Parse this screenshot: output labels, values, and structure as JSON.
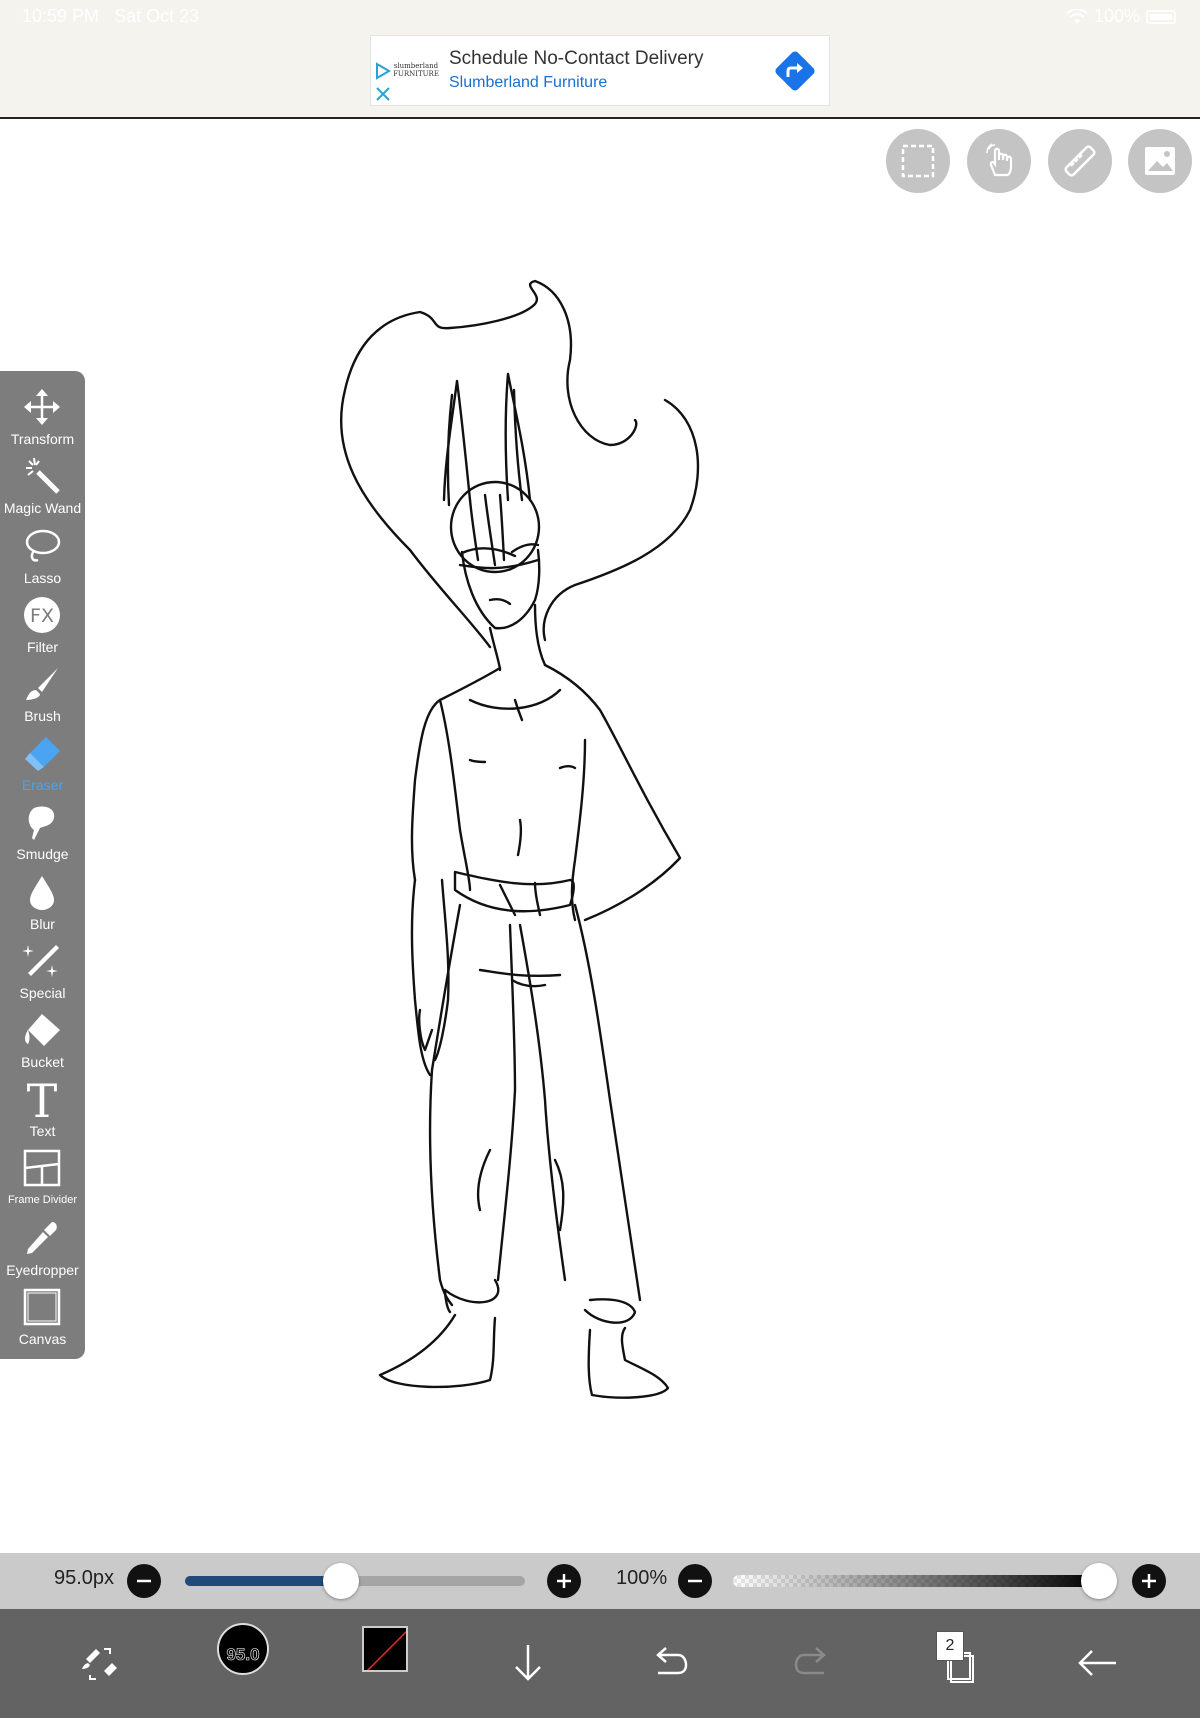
{
  "status_bar": {
    "time": "10:59 PM",
    "date": "Sat Oct 23",
    "battery": "100%"
  },
  "ad": {
    "logo_text": "slumberland FURNITURE",
    "title": "Schedule No-Contact Delivery",
    "subtitle": "Slumberland Furniture"
  },
  "top_buttons": [
    "selection-icon",
    "touch-hand-icon",
    "ruler-icon",
    "image-icon"
  ],
  "toolbar": {
    "tools": [
      {
        "name": "transform",
        "label": "Transform",
        "icon": "move-arrows-icon"
      },
      {
        "name": "magic-wand",
        "label": "Magic Wand",
        "icon": "magic-wand-icon"
      },
      {
        "name": "lasso",
        "label": "Lasso",
        "icon": "lasso-icon"
      },
      {
        "name": "filter",
        "label": "Filter",
        "icon": "fx-icon"
      },
      {
        "name": "brush",
        "label": "Brush",
        "icon": "brush-icon"
      },
      {
        "name": "eraser",
        "label": "Eraser",
        "icon": "eraser-icon"
      },
      {
        "name": "smudge",
        "label": "Smudge",
        "icon": "smudge-icon"
      },
      {
        "name": "blur",
        "label": "Blur",
        "icon": "droplet-icon"
      },
      {
        "name": "special",
        "label": "Special",
        "icon": "special-brush-icon"
      },
      {
        "name": "bucket",
        "label": "Bucket",
        "icon": "bucket-icon"
      },
      {
        "name": "text",
        "label": "Text",
        "icon": "text-icon"
      },
      {
        "name": "frame-divider",
        "label": "Frame Divider",
        "icon": "frame-divider-icon"
      },
      {
        "name": "eyedropper",
        "label": "Eyedropper",
        "icon": "eyedropper-icon"
      },
      {
        "name": "canvas",
        "label": "Canvas",
        "icon": "canvas-icon"
      }
    ],
    "active_tool": "Eraser",
    "active_color": "#4ba3f2"
  },
  "sliders": {
    "size_label": "95.0px",
    "size_fraction": 0.46,
    "opacity_label": "100%",
    "opacity_fraction": 1.0
  },
  "bottom_bar": {
    "brush_size": "95.0",
    "layers_count": "2",
    "icons": [
      "quick-menu-icon",
      "brush-size-icon",
      "color-swatch",
      "download-icon",
      "undo-icon",
      "redo-icon",
      "layers-icon",
      "back-arrow-icon"
    ]
  },
  "colors": {
    "toolbar_bg": "#7d7d7d",
    "bottom_bar_bg": "#636363",
    "slider_bar_bg": "#cacaca",
    "size_fill": "#1f4a7a",
    "ad_link": "#1a6fd4"
  }
}
